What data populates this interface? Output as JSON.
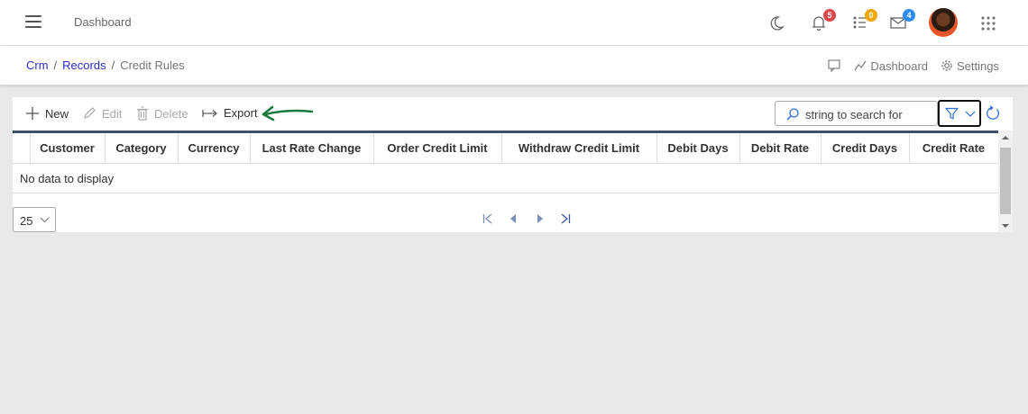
{
  "topbar": {
    "title": "Dashboard",
    "notifications_count": "5",
    "tasks_count": "0",
    "messages_count": "4",
    "badge_colors": {
      "notifications": "#e04848",
      "tasks": "#f0a500",
      "messages": "#2d8cf0"
    }
  },
  "breadcrumb": {
    "items": [
      "Crm",
      "Records"
    ],
    "current": "Credit Rules"
  },
  "page_actions": {
    "dashboard": "Dashboard",
    "settings": "Settings"
  },
  "toolbar": {
    "new": "New",
    "edit": "Edit",
    "delete": "Delete",
    "export": "Export",
    "search_placeholder": "string to search for"
  },
  "grid": {
    "columns": [
      "Customer",
      "Category",
      "Currency",
      "Last Rate Change",
      "Order Credit Limit",
      "Withdraw Credit Limit",
      "Debit Days",
      "Debit Rate",
      "Credit Days",
      "Credit Rate"
    ],
    "empty_text": "No data to display"
  },
  "pager": {
    "page_size": "25"
  },
  "colors": {
    "link": "#2a2ad0",
    "header_rule": "#3d4f6a",
    "annotation_arrow": "#1a7a40",
    "accent": "#2d6fd6"
  }
}
